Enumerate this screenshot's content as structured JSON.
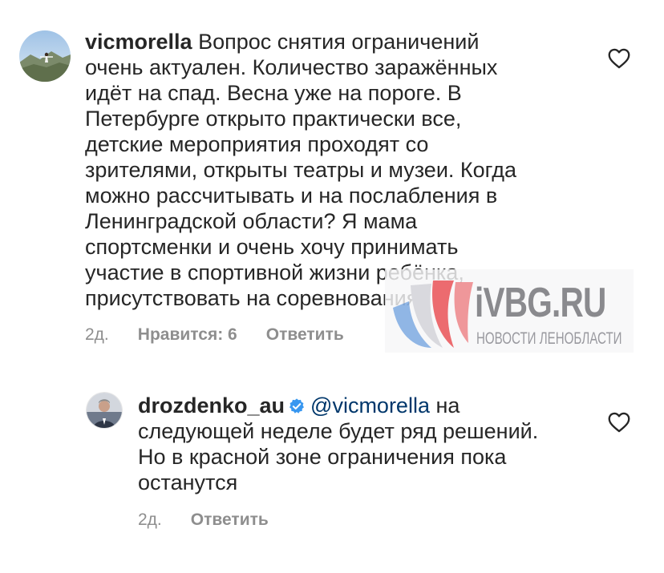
{
  "comments": [
    {
      "username": "vicmorella",
      "text": "Вопрос снятия ограничений очень актуален. Количество заражённых идёт на спад. Весна уже на пороге. В Петербурге открыто практически все, детские мероприятия проходят со зрителями, открыты театры и музеи. Когда можно рассчитывать и на послабления в Ленинградской области? Я мама спортсменки и очень хочу принимать участие в спортивной жизни ребёнка, присутствовать на соревнованиях",
      "lines": [
        "очень актуален. Количество заражённых",
        "идёт на спад. Весна уже на пороге. В",
        "Петербурге открыто практически все,",
        "детские мероприятия проходят со",
        "зрителями, открыты театры и музеи. Когда",
        "можно рассчитывать и на послабления в",
        "Ленинградской области? Я мама",
        "спортсменки и очень хочу принимать",
        "участие в спортивной жизни ребёнка,",
        "присутствовать на соревнованиях"
      ],
      "first_line": "Вопрос снятия ограничений",
      "age": "2д.",
      "likes_label": "Нравится: 6",
      "reply_label": "Ответить",
      "like_icon": "heart-outline-icon"
    },
    {
      "username": "drozdenko_au",
      "verified": true,
      "mention": "@vicmorella",
      "first_line": "на",
      "lines": [
        "следующей неделе будет ряд решений.",
        "Но в красной зоне ограничения пока",
        "останутся"
      ],
      "age": "2д.",
      "reply_label": "Ответить",
      "like_icon": "heart-outline-icon"
    }
  ],
  "watermark": {
    "title": "iVBG.RU",
    "subtitle": "НОВОСТИ ЛЕНОБЛАСТИ"
  },
  "colors": {
    "text": "#262626",
    "meta": "#8e8e8e",
    "mention": "#00376b",
    "verified": "#3897f0",
    "logo_red": "#e8474c",
    "logo_blue": "#3b7fd6"
  }
}
